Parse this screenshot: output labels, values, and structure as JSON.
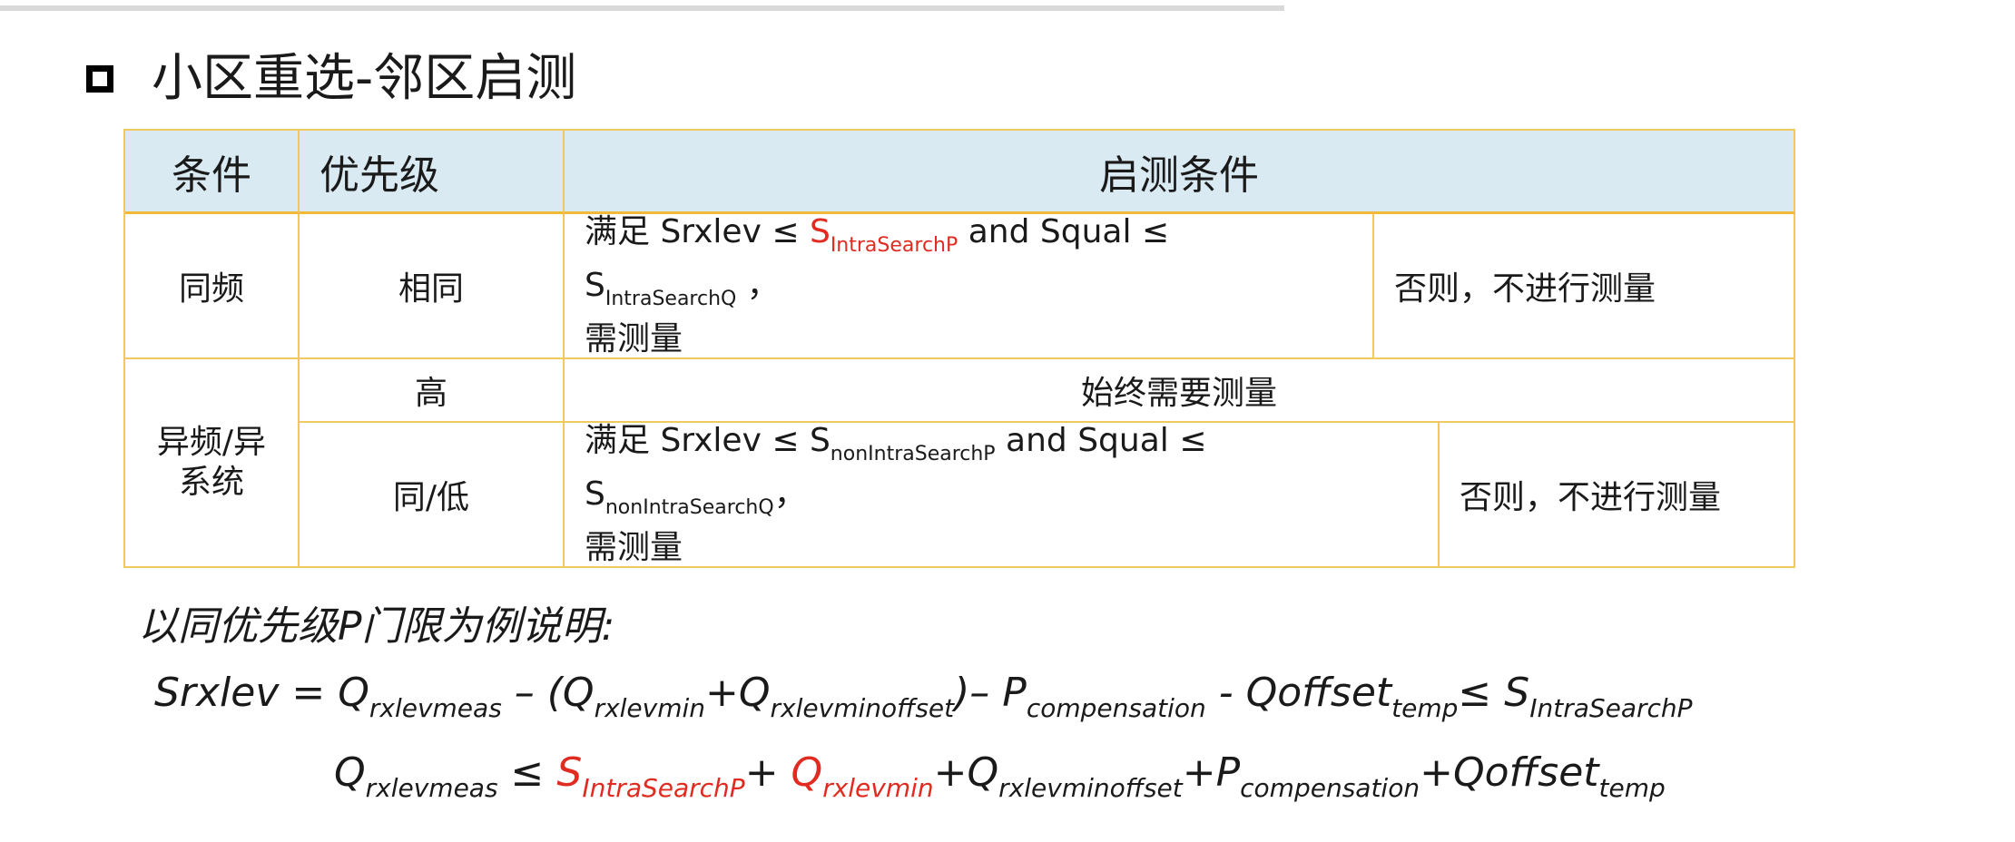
{
  "title": "小区重选-邻区启测",
  "table": {
    "headers": [
      "条件",
      "优先级",
      "启测条件"
    ],
    "row_same": {
      "condition": "同频",
      "priority": "相同",
      "line1_a": "满足 Srxlev ≤ ",
      "line1_s": "S",
      "line1_sub": "IntraSearchP",
      "line1_b": " and Squal ≤",
      "line2_s": "S",
      "line2_sub": "IntraSearchQ",
      "line2_b": " ，",
      "line3": "需测量",
      "otherwise": "否则，不进行测量"
    },
    "row_inter": {
      "condition": "异频/异系统",
      "high_priority": "高",
      "high_text": "始终需要测量",
      "low_priority": "同/低",
      "line1_a": "满足 Srxlev ≤ S",
      "line1_sub": "nonIntraSearchP",
      "line1_b": " and Squal ≤",
      "line2_s": "S",
      "line2_sub": "nonIntraSearchQ",
      "line2_b": "，",
      "line3": "需测量",
      "otherwise": "否则，不进行测量"
    }
  },
  "note": "以同优先级P门限为例说明:",
  "formula1": {
    "t0": "Srxlev  =  Q",
    "s0": "rxlevmeas",
    "t1": " – (Q",
    "s1": "rxlevmin",
    "t2": "+Q",
    "s2": "rxlevminoffset",
    "t3": ")– P",
    "s3": "compensation",
    "t4": " - Qoffset",
    "s4": "temp",
    "t5": "≤ S",
    "s5": "IntraSearchP"
  },
  "formula2": {
    "t0": "Q",
    "s0": "rxlevmeas",
    "t1": " ≤ ",
    "r1": "S",
    "rs1": "IntraSearchP",
    "t2": "+ ",
    "r2": "Q",
    "rs2": "rxlevmin",
    "t3": "+Q",
    "s3": "rxlevminoffset",
    "t4": "+P",
    "s4": "compensation",
    "t5": "+Qoffset",
    "s5": "temp"
  }
}
